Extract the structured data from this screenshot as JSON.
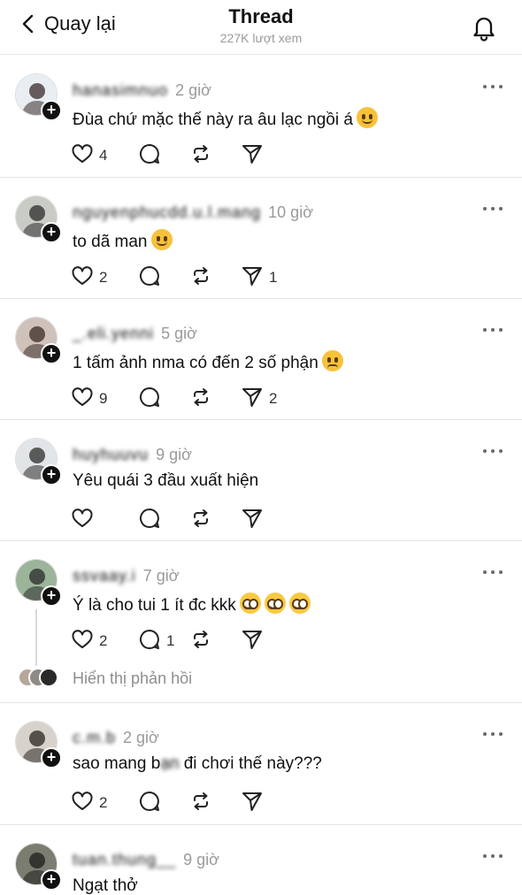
{
  "header": {
    "back_label": "Quay lại",
    "title": "Thread",
    "views": "227K lượt xem"
  },
  "comments": [
    {
      "username": "hanasimnuo",
      "time": "2 giờ",
      "text": "Đùa chứ mặc thế này ra âu lạc ngồi á",
      "emojis": [
        "grinning-sweat"
      ],
      "likes": "4",
      "replies": "",
      "shares": "",
      "avatar": {
        "bg": "#e9eef2",
        "fg": "#3a2a2a"
      }
    },
    {
      "username": "nguyenphucdd.u.l.mang",
      "time": "10 giờ",
      "text": "to dã man",
      "emojis": [
        "joy"
      ],
      "likes": "2",
      "replies": "",
      "shares": "1",
      "avatar": {
        "bg": "#c9ccc5",
        "fg": "#2b2b2b"
      }
    },
    {
      "username": "_.eli.yenni",
      "time": "5 giờ",
      "text": "1 tấm ảnh nma có đến 2 số phận",
      "emojis": [
        "pensive"
      ],
      "likes": "9",
      "replies": "",
      "shares": "2",
      "avatar": {
        "bg": "#cfc2bb",
        "fg": "#3b2b26"
      }
    },
    {
      "username": "huyhuuvu",
      "time": "9 giờ",
      "text": "Yêu quái 3 đầu xuất hiện",
      "emojis": [],
      "likes": "",
      "replies": "",
      "shares": "",
      "avatar": {
        "bg": "#e2e5e8",
        "fg": "#2b2b2b"
      }
    },
    {
      "username": "ssvaay.i",
      "time": "7 giờ",
      "text": "Ý là cho tui 1 ít đc kkk",
      "emojis": [
        "pleading",
        "pleading",
        "pleading"
      ],
      "likes": "2",
      "replies": "1",
      "shares": "",
      "avatar": {
        "bg": "#9bb49a",
        "fg": "#2a2a2a"
      },
      "show_replies": "Hiển thị phản hồi"
    },
    {
      "username": "c.m.b",
      "time": "2 giờ",
      "text_before": "sao mang b",
      "text_blur": "ạn",
      "text_after": " đi chơi thế này???",
      "emojis": [],
      "likes": "2",
      "replies": "",
      "shares": "",
      "avatar": {
        "bg": "#d8d2cc",
        "fg": "#2b2420"
      }
    },
    {
      "username": "tuan.thung__",
      "time": "9 giờ",
      "text": "Ngạt thở",
      "emojis": [],
      "likes": "",
      "replies": "",
      "shares": "",
      "avatar": {
        "bg": "#7a7d70",
        "fg": "#1d1d1b"
      }
    }
  ],
  "colors": {
    "text": "#111111",
    "muted": "#9a9a9a",
    "divider": "#e3e3e3"
  }
}
